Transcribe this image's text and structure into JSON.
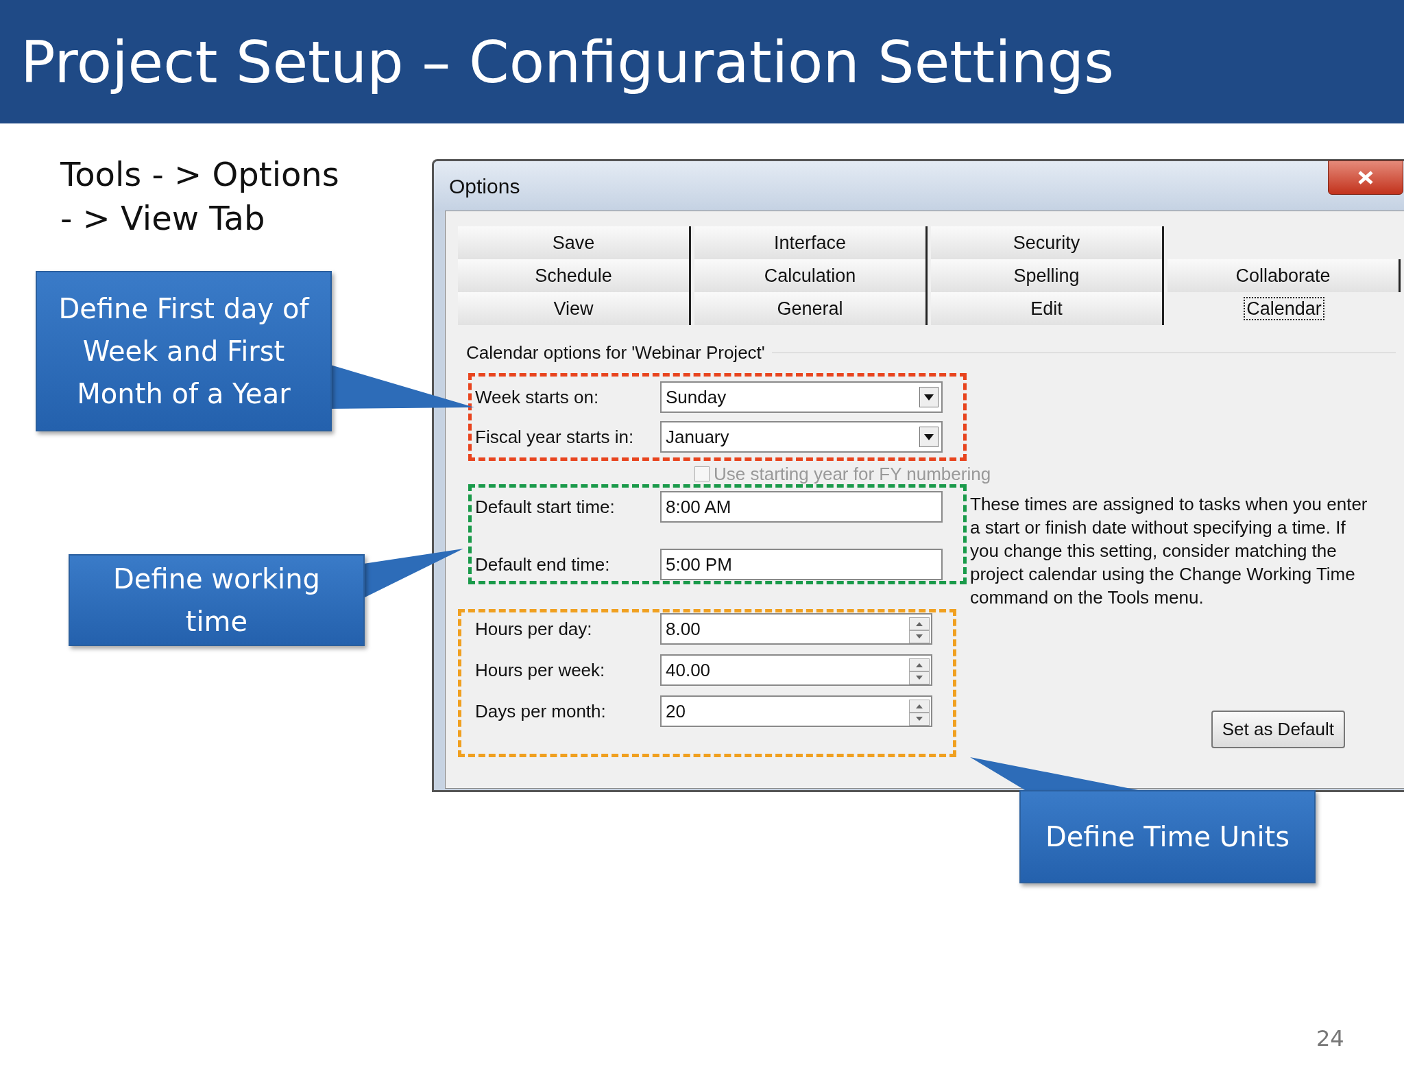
{
  "slide": {
    "title": "Project Setup – Configuration Settings",
    "page_number": "24"
  },
  "path_note": "Tools - > Options - > View Tab",
  "callouts": [
    {
      "text": "Define First day of Week and First Month of a Year"
    },
    {
      "text": "Define working time"
    },
    {
      "text": "Define Time Units"
    }
  ],
  "dialog": {
    "title": "Options",
    "tab_rows": [
      {
        "tabs": [
          {
            "label": "Save",
            "selected": false
          },
          {
            "label": "Interface",
            "selected": false
          },
          {
            "label": "Security",
            "selected": false
          }
        ]
      },
      {
        "tabs": [
          {
            "label": "Schedule",
            "selected": false
          },
          {
            "label": "Calculation",
            "selected": false
          },
          {
            "label": "Spelling",
            "selected": false
          },
          {
            "label": "Collaborate",
            "selected": false
          }
        ]
      },
      {
        "tabs": [
          {
            "label": "View",
            "selected": false
          },
          {
            "label": "General",
            "selected": false
          },
          {
            "label": "Edit",
            "selected": false
          },
          {
            "label": "Calendar",
            "selected": true
          }
        ]
      }
    ],
    "section_title": "Calendar options for 'Webinar Project'",
    "groups": [
      {
        "color": "#e8441e",
        "fields": [
          {
            "kind": "dropdown",
            "label": "Week starts on:",
            "value": "Sunday"
          },
          {
            "kind": "dropdown",
            "label": "Fiscal year starts in:",
            "value": "January"
          }
        ]
      },
      {
        "color": "#1a9a4a",
        "fields": [
          {
            "kind": "text",
            "label": "Default start time:",
            "value": "8:00 AM"
          },
          {
            "kind": "text",
            "label": "Default end time:",
            "value": "5:00 PM"
          }
        ]
      },
      {
        "color": "#f0a020",
        "fields": [
          {
            "kind": "spin",
            "label": "Hours per day:",
            "value": "8.00"
          },
          {
            "kind": "spin",
            "label": "Hours per week:",
            "value": "40.00"
          },
          {
            "kind": "spin",
            "label": "Days per month:",
            "value": "20"
          }
        ]
      }
    ],
    "checkbox": {
      "label": "Use starting year for FY numbering",
      "checked": false,
      "disabled": true
    },
    "description": "These times are assigned to tasks when you enter a start or finish date without specifying a time. If you change this setting, consider matching the project calendar using the Change Working Time command on the Tools menu.",
    "button": "Set as Default"
  }
}
